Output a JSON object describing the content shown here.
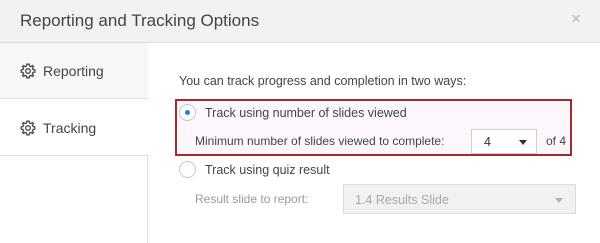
{
  "dialog": {
    "title": "Reporting and Tracking Options",
    "close_label": "×"
  },
  "sidebar": {
    "items": [
      {
        "label": "Reporting",
        "icon": "gear-icon"
      },
      {
        "label": "Tracking",
        "icon": "gear-icon"
      }
    ]
  },
  "tracking": {
    "intro": "You can track progress and completion in two ways:",
    "option_slides": {
      "label": "Track using number of slides viewed",
      "selected": true,
      "min_label": "Minimum number of slides viewed to complete:",
      "min_value": "4",
      "of_label": "of 4"
    },
    "option_quiz": {
      "label": "Track using quiz result",
      "selected": false,
      "result_label": "Result slide to report:",
      "result_value": "1.4 Results Slide"
    }
  },
  "colors": {
    "accent": "#2d7bd3",
    "highlight_border": "#a52a2a"
  }
}
